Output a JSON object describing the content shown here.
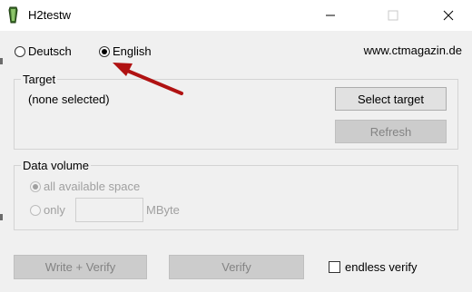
{
  "window": {
    "title": "H2testw",
    "minimize_icon": "minimize-icon",
    "maximize_icon": "maximize-icon",
    "close_icon": "close-icon"
  },
  "language": {
    "options": [
      {
        "label": "Deutsch",
        "selected": false
      },
      {
        "label": "English",
        "selected": true
      }
    ]
  },
  "website": "www.ctmagazin.de",
  "target": {
    "group_label": "Target",
    "status": "(none selected)",
    "select_button": "Select target",
    "refresh_button": "Refresh"
  },
  "data_volume": {
    "group_label": "Data volume",
    "option_all": "all available space",
    "option_only": "only",
    "amount_value": "",
    "unit": "MByte"
  },
  "actions": {
    "write_verify_button": "Write + Verify",
    "verify_button": "Verify",
    "endless_verify_label": "endless verify",
    "endless_verify_checked": false
  },
  "annotation": {
    "arrow_color": "#b01212"
  }
}
